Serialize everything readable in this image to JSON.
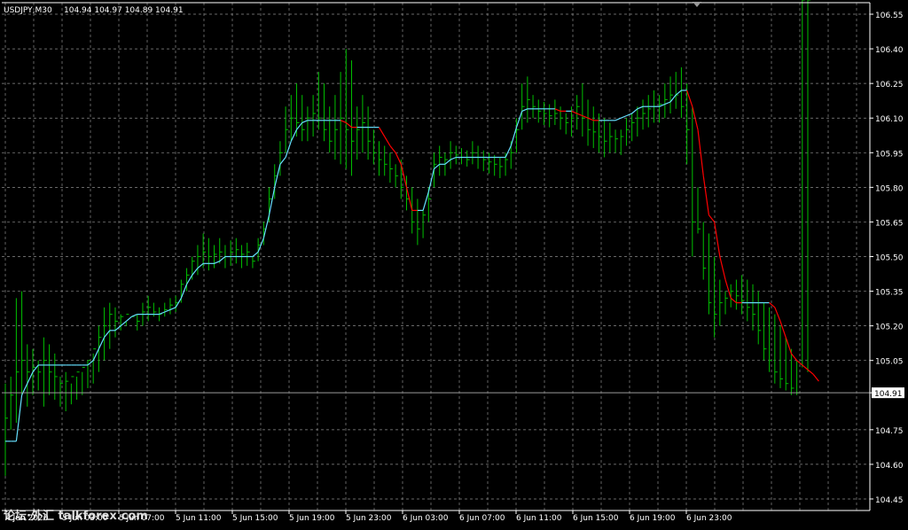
{
  "header": {
    "symbol_timeframe": "USDJPY,M30",
    "ohlc": "104.94 104.97 104.89 104.91"
  },
  "watermark": "论坛·外汇 talkforex.com",
  "colors": {
    "background": "#000000",
    "grid": "#8c8c8c",
    "bars": "#00c000",
    "ma_up": "#66e0ff",
    "ma_down": "#ff0000",
    "ma_turn": "#ffff00",
    "axis_text": "#ffffff",
    "price_line": "#9a9a9a"
  },
  "chart_data": {
    "type": "line",
    "title": "",
    "xlabel": "",
    "ylabel": "",
    "ylim": [
      104.4,
      106.6
    ],
    "y_ticks": [
      "106.55",
      "106.40",
      "106.25",
      "106.10",
      "105.95",
      "105.80",
      "105.65",
      "105.50",
      "105.35",
      "105.20",
      "105.05",
      "104.91",
      "104.75",
      "104.60",
      "104.45"
    ],
    "x_ticks": [
      "4 Jun 2020",
      "5 Jun 03:00",
      "5 Jun 07:00",
      "5 Jun 11:00",
      "5 Jun 15:00",
      "5 Jun 19:00",
      "5 Jun 23:00",
      "6 Jun 03:00",
      "6 Jun 07:00",
      "6 Jun 11:00",
      "6 Jun 15:00",
      "6 Jun 19:00",
      "6 Jun 23:00"
    ],
    "current_price": 104.91,
    "bars": {
      "name": "",
      "high": [
        104.95,
        104.98,
        105.32,
        105.35,
        105.12,
        105.1,
        105.05,
        105.15,
        105.12,
        105.08,
        104.98,
        105.0,
        104.95,
        104.98,
        105.0,
        105.05,
        105.08,
        105.2,
        105.28,
        105.3,
        105.28,
        105.25,
        105.22,
        105.2,
        105.25,
        105.3,
        105.33,
        105.3,
        105.28,
        105.3,
        105.32,
        105.33,
        105.4,
        105.45,
        105.5,
        105.55,
        105.6,
        105.58,
        105.55,
        105.58,
        105.55,
        105.57,
        105.58,
        105.55,
        105.56,
        105.5,
        105.58,
        105.65,
        105.8,
        105.9,
        106.0,
        106.15,
        106.2,
        106.25,
        106.2,
        106.15,
        106.2,
        106.3,
        106.25,
        106.15,
        106.2,
        106.3,
        106.4,
        106.35,
        106.15,
        106.2,
        106.15,
        106.05,
        106.0,
        105.98,
        105.95,
        105.9,
        105.92,
        105.85,
        105.8,
        105.75,
        105.7,
        105.8,
        105.95,
        105.98,
        105.95,
        106.0,
        105.98,
        105.97,
        105.96,
        106.0,
        105.98,
        105.96,
        105.95,
        105.94,
        105.93,
        105.95,
        106.0,
        106.1,
        106.25,
        106.28,
        106.2,
        106.18,
        106.17,
        106.16,
        106.18,
        106.15,
        106.12,
        106.15,
        106.2,
        106.25,
        106.18,
        106.15,
        106.12,
        106.1,
        106.08,
        106.05,
        106.05,
        106.1,
        106.12,
        106.15,
        106.18,
        106.2,
        106.22,
        106.2,
        106.25,
        106.28,
        106.3,
        106.32,
        106.25,
        106.15,
        105.8,
        105.65,
        105.6,
        105.5,
        105.4,
        105.35,
        105.38,
        105.4,
        105.42,
        105.4,
        105.38,
        105.35,
        105.3,
        105.28,
        105.25,
        105.2,
        105.15,
        105.1,
        105.05,
        105.02,
        105.0
      ],
      "low": [
        104.55,
        104.75,
        104.78,
        104.9,
        104.85,
        104.9,
        104.92,
        104.85,
        104.9,
        104.88,
        104.85,
        104.83,
        104.86,
        104.88,
        104.9,
        104.93,
        104.95,
        105.0,
        105.05,
        105.1,
        105.15,
        105.18,
        105.2,
        105.2,
        105.18,
        105.2,
        105.22,
        105.24,
        105.22,
        105.24,
        105.25,
        105.26,
        105.3,
        105.35,
        105.4,
        105.42,
        105.45,
        105.44,
        105.45,
        105.47,
        105.45,
        105.46,
        105.47,
        105.45,
        105.46,
        105.45,
        105.48,
        105.55,
        105.65,
        105.75,
        105.85,
        105.95,
        106.0,
        106.02,
        106.0,
        106.0,
        106.02,
        106.05,
        106.0,
        105.95,
        105.92,
        105.9,
        105.88,
        105.85,
        105.92,
        105.95,
        105.92,
        105.9,
        105.85,
        105.85,
        105.82,
        105.8,
        105.75,
        105.7,
        105.6,
        105.55,
        105.58,
        105.65,
        105.8,
        105.85,
        105.85,
        105.88,
        105.9,
        105.9,
        105.89,
        105.9,
        105.88,
        105.87,
        105.86,
        105.85,
        105.84,
        105.85,
        105.88,
        105.95,
        106.05,
        106.08,
        106.1,
        106.08,
        106.07,
        106.06,
        106.07,
        106.05,
        106.03,
        106.02,
        106.05,
        106.02,
        105.98,
        105.97,
        105.95,
        105.93,
        105.95,
        105.95,
        105.94,
        105.98,
        106.0,
        106.02,
        106.05,
        106.06,
        106.08,
        106.08,
        106.1,
        106.12,
        106.14,
        106.1,
        105.9,
        105.5,
        105.6,
        105.4,
        105.25,
        105.15,
        105.2,
        105.25,
        105.28,
        105.27,
        105.25,
        105.22,
        105.18,
        105.12,
        105.05,
        105.0,
        104.95,
        104.93,
        104.92,
        104.9,
        104.9
      ],
      "close": [
        104.8,
        104.9,
        105.0,
        105.05,
        105.0,
        105.02,
        105.0,
        105.05,
        105.0,
        104.98,
        104.95,
        104.96,
        104.98,
        105.0,
        105.02,
        105.05,
        105.1,
        105.15,
        105.2,
        105.25,
        105.22,
        105.24,
        105.25,
        105.24,
        105.22,
        105.26,
        105.28,
        105.26,
        105.25,
        105.27,
        105.29,
        105.3,
        105.38,
        105.42,
        105.48,
        105.5,
        105.52,
        105.5,
        105.51,
        105.52,
        105.5,
        105.52,
        105.53,
        105.51,
        105.52,
        105.48,
        105.55,
        105.62,
        105.75,
        105.85,
        105.95,
        106.05,
        106.1,
        106.08,
        106.05,
        106.1,
        106.12,
        106.1,
        106.05,
        106.0,
        106.05,
        106.1,
        106.05,
        106.0,
        106.05,
        106.08,
        106.0,
        105.95,
        105.92,
        105.9,
        105.88,
        105.85,
        105.8,
        105.75,
        105.65,
        105.62,
        105.68,
        105.75,
        105.9,
        105.93,
        105.92,
        105.95,
        105.94,
        105.93,
        105.92,
        105.95,
        105.93,
        105.92,
        105.91,
        105.9,
        105.89,
        105.92,
        105.95,
        106.05,
        106.15,
        106.18,
        106.15,
        106.13,
        106.12,
        106.11,
        106.12,
        106.1,
        106.08,
        106.1,
        106.15,
        106.1,
        106.05,
        106.04,
        106.02,
        106.0,
        106.02,
        106.01,
        106.02,
        106.05,
        106.08,
        106.1,
        106.12,
        106.14,
        106.15,
        106.16,
        106.18,
        106.2,
        106.2,
        106.15,
        106.05,
        105.65,
        105.62,
        105.45,
        105.3,
        105.25,
        105.3,
        105.32,
        105.35,
        105.33,
        105.31,
        105.28,
        105.25,
        105.18,
        105.1,
        105.05,
        105.0,
        104.97,
        104.95,
        104.93,
        104.91
      ]
    },
    "moving_average": {
      "name": "",
      "values": [
        104.7,
        104.7,
        104.7,
        104.9,
        104.95,
        105.0,
        105.03,
        105.03,
        105.03,
        105.03,
        105.03,
        105.03,
        105.03,
        105.03,
        105.03,
        105.03,
        105.05,
        105.1,
        105.15,
        105.18,
        105.18,
        105.2,
        105.22,
        105.24,
        105.25,
        105.25,
        105.25,
        105.25,
        105.25,
        105.26,
        105.27,
        105.28,
        105.32,
        105.38,
        105.42,
        105.45,
        105.47,
        105.47,
        105.47,
        105.48,
        105.5,
        105.5,
        105.5,
        105.5,
        105.5,
        105.5,
        105.52,
        105.58,
        105.68,
        105.8,
        105.9,
        105.93,
        106.0,
        106.05,
        106.08,
        106.09,
        106.09,
        106.09,
        106.09,
        106.09,
        106.09,
        106.09,
        106.08,
        106.06,
        106.06,
        106.06,
        106.06,
        106.06,
        106.06,
        106.02,
        105.98,
        105.95,
        105.9,
        105.8,
        105.7,
        105.7,
        105.7,
        105.78,
        105.88,
        105.9,
        105.9,
        105.92,
        105.93,
        105.93,
        105.93,
        105.93,
        105.93,
        105.93,
        105.93,
        105.93,
        105.93,
        105.93,
        105.98,
        106.06,
        106.13,
        106.14,
        106.14,
        106.14,
        106.14,
        106.14,
        106.14,
        106.13,
        106.13,
        106.13,
        106.12,
        106.11,
        106.1,
        106.09,
        106.09,
        106.09,
        106.09,
        106.09,
        106.1,
        106.11,
        106.12,
        106.14,
        106.15,
        106.15,
        106.15,
        106.15,
        106.16,
        106.17,
        106.2,
        106.22,
        106.22,
        106.15,
        106.05,
        105.85,
        105.68,
        105.65,
        105.5,
        105.4,
        105.32,
        105.3,
        105.3,
        105.3,
        105.3,
        105.3,
        105.3,
        105.3,
        105.28,
        105.22,
        105.15,
        105.08,
        105.05,
        105.03,
        105.01,
        104.99,
        104.96
      ]
    }
  }
}
